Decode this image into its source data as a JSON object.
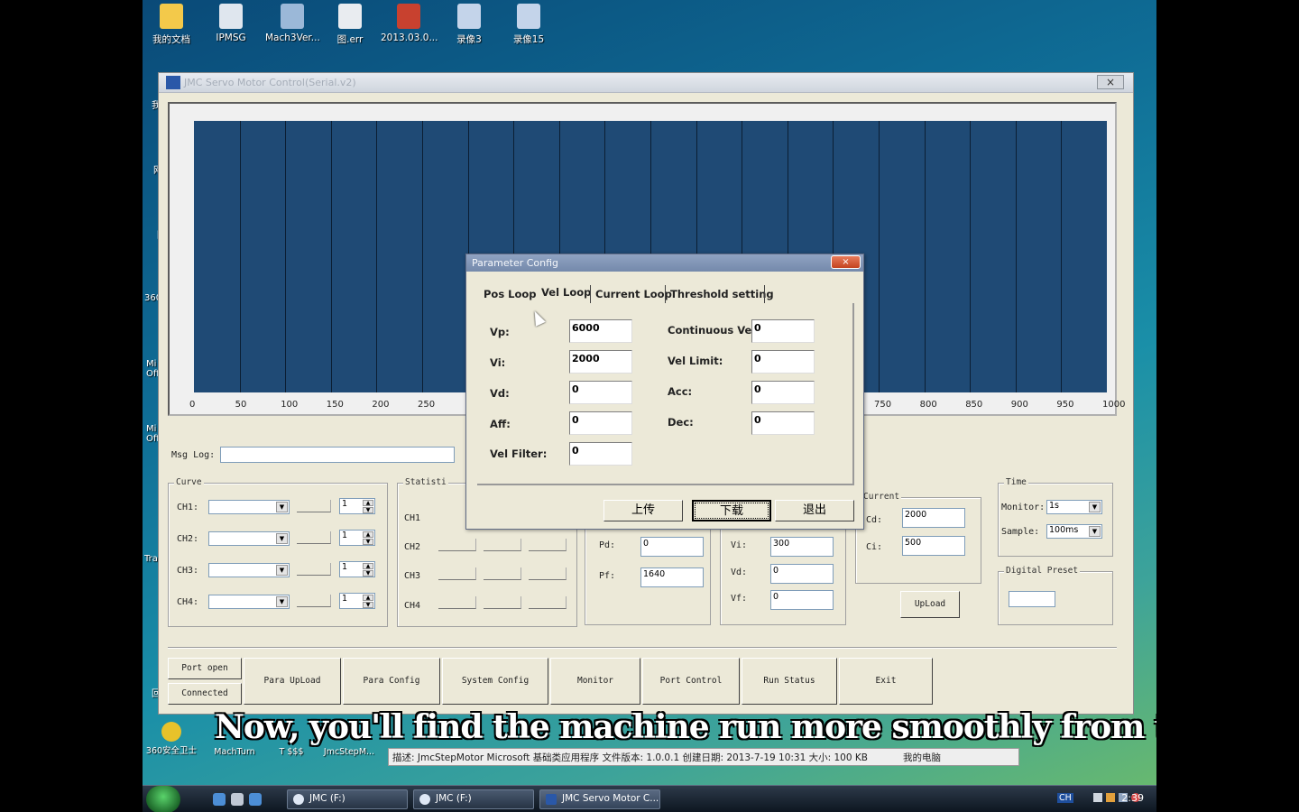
{
  "desktop": {
    "top_icons": [
      {
        "label": "我的文档",
        "color": "#f3c94a"
      },
      {
        "label": "IPMSG",
        "color": "#dfe6ee"
      },
      {
        "label": "Mach3Ver...",
        "color": "#9bb8d8"
      },
      {
        "label": "图.err",
        "color": "#e9ecf0"
      },
      {
        "label": "2013.03.0...",
        "color": "#c8412f"
      },
      {
        "label": "录像3",
        "color": "#c4d4ea"
      },
      {
        "label": "录像15",
        "color": "#c4d4ea"
      }
    ],
    "left_icons": [
      "我",
      "网",
      "回",
      "360s",
      "Mi Offi",
      "Mi Offi",
      "S",
      "Trac",
      "回"
    ],
    "bottom_icons": [
      "360安全卫士",
      "MachTurn",
      "T $$$",
      "JmcStepM..."
    ]
  },
  "main_window": {
    "title": "JMC Servo Motor Control(Serial.v2)",
    "close": "×",
    "x_ticks": [
      "0",
      "50",
      "100",
      "150",
      "200",
      "250",
      "750",
      "800",
      "850",
      "900",
      "950",
      "1000"
    ],
    "msg_log_label": "Msg Log:",
    "curve": {
      "title": "Curve",
      "channels": [
        {
          "label": "CH1:",
          "spin": "1"
        },
        {
          "label": "CH2:",
          "spin": "1"
        },
        {
          "label": "CH3:",
          "spin": "1"
        },
        {
          "label": "CH4:",
          "spin": "1"
        }
      ]
    },
    "statistics": {
      "title": "Statisti",
      "rows": [
        "CH1",
        "CH2",
        "CH3",
        "CH4"
      ]
    },
    "pos_group": {
      "pd_label": "Pd:",
      "pd_value": "0",
      "pf_label": "Pf:",
      "pf_value": "1640"
    },
    "vel_group": {
      "vi_label": "Vi:",
      "vi_value": "300",
      "vd_label": "Vd:",
      "vd_value": "0",
      "vf_label": "Vf:",
      "vf_value": "0"
    },
    "current": {
      "title": "Current",
      "cd_label": "Cd:",
      "cd_value": "2000",
      "ci_label": "Ci:",
      "ci_value": "500",
      "upload": "UpLoad"
    },
    "time": {
      "title": "Time",
      "monitor_label": "Monitor:",
      "monitor_value": "1s",
      "sample_label": "Sample:",
      "sample_value": "100ms"
    },
    "digital_preset": {
      "title": "Digital Preset"
    },
    "bottom_buttons": {
      "port_open": "Port open",
      "connected": "Connected",
      "para_upload": "Para UpLoad",
      "para_config": "Para Config",
      "system_config": "System Config",
      "monitor": "Monitor",
      "port_control": "Port Control",
      "run_status": "Run Status",
      "exit": "Exit"
    }
  },
  "dialog": {
    "title": "Parameter Config",
    "close": "×",
    "tabs": [
      "Pos Loop",
      "Vel Loop",
      "Current Loop",
      "Threshold setting"
    ],
    "active_tab": "Vel Loop",
    "left_params": [
      {
        "label": "Vp:",
        "value": "6000"
      },
      {
        "label": "Vi:",
        "value": "2000"
      },
      {
        "label": "Vd:",
        "value": "0"
      },
      {
        "label": "Aff:",
        "value": "0"
      },
      {
        "label": "Vel Filter:",
        "value": "0"
      }
    ],
    "right_params": [
      {
        "label": "Continuous Vel:",
        "value": "0"
      },
      {
        "label": "Vel Limit:",
        "value": "0"
      },
      {
        "label": "Acc:",
        "value": "0"
      },
      {
        "label": "Dec:",
        "value": "0"
      }
    ],
    "buttons": {
      "upload": "上传",
      "download": "下载",
      "exit": "退出"
    }
  },
  "subtitle": "Now, you'll find the machine run more smoothly from the vedio:",
  "infobar": {
    "text": "描述: JmcStepMotor Microsoft 基础类应用程序 文件版本: 1.0.0.1 创建日期: 2013-7-19 10:31 大小: 100 KB",
    "computer": "我的电脑"
  },
  "taskbar": {
    "buttons": [
      "JMC (F:)",
      "JMC (F:)",
      "JMC Servo Motor C..."
    ],
    "lang": "CH",
    "clock": "2:39"
  },
  "colors": {
    "plot_bg": "#1f4a75",
    "window_bg": "#ece9d8"
  }
}
